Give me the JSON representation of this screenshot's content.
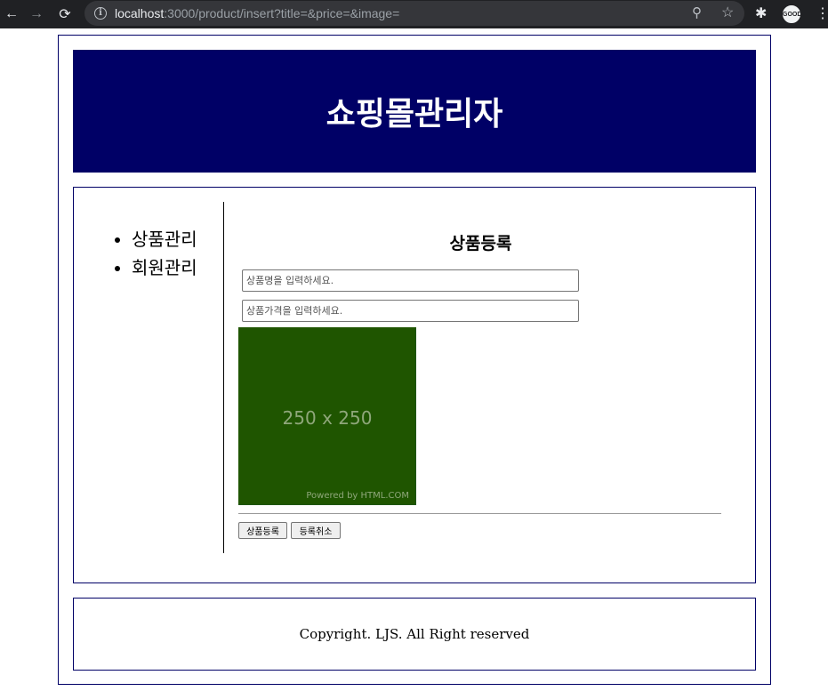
{
  "browser": {
    "url_host": "localhost",
    "url_rest": ":3000/product/insert?title=&price=&image=",
    "back_icon": "←",
    "forward_icon": "→",
    "reload_icon": "⟳",
    "info_icon": "i",
    "zoom_icon": "⚲",
    "star_icon": "☆",
    "extensions_icon": "✱",
    "profile_label": "GOOD",
    "menu_icon": "⋮"
  },
  "header": {
    "title": "쇼핑몰관리자"
  },
  "sidebar": {
    "items": [
      {
        "label": "상품관리"
      },
      {
        "label": "회원관리"
      }
    ]
  },
  "form": {
    "heading": "상품등록",
    "title_placeholder": "상품명을 입력하세요.",
    "title_value": "",
    "price_placeholder": "상품가격을 입력하세요.",
    "price_value": "",
    "image": {
      "size_label": "250 x 250",
      "powered_label": "Powered by HTML.COM",
      "background": "#1f5500"
    },
    "submit_label": "상품등록",
    "cancel_label": "등록취소"
  },
  "footer": {
    "copyright": "Copyright. LJS. All Right reserved"
  },
  "colors": {
    "header_bg": "#000066",
    "border": "#000066"
  }
}
